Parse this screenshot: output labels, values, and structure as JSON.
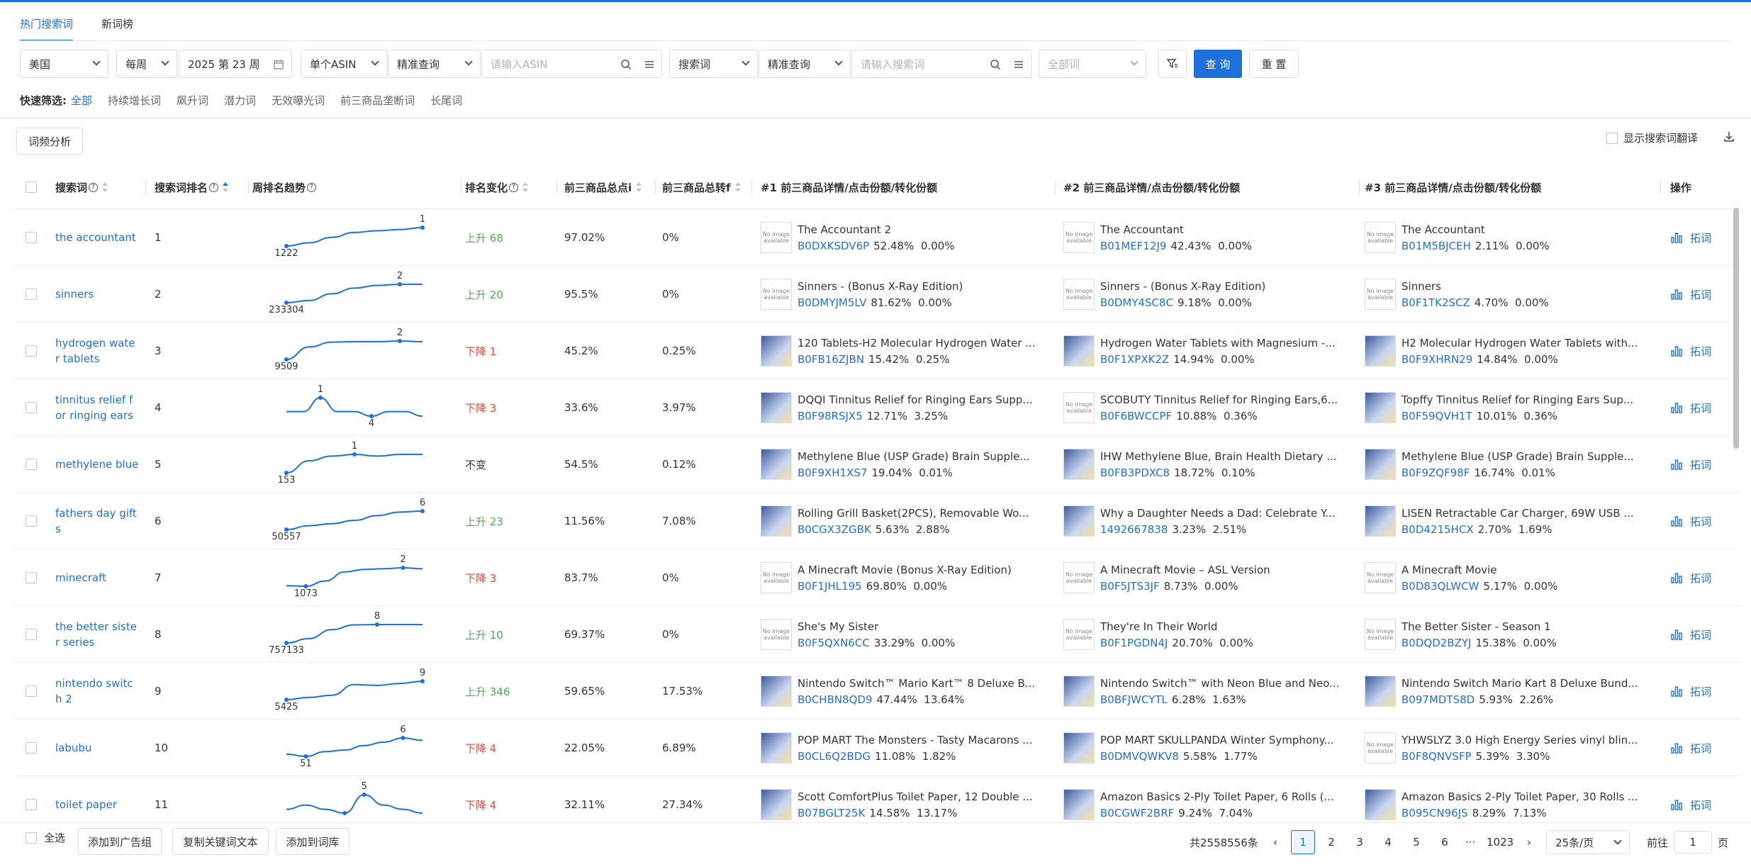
{
  "tabs": [
    "热门搜索词",
    "新词榜"
  ],
  "filters": {
    "country": "美国",
    "period": "每周",
    "week": "2025 第 23 周",
    "asin_mode": "单个ASIN",
    "asin_match": "精准查询",
    "asin_placeholder": "请输入ASIN",
    "kw_mode": "搜索词",
    "kw_match": "精准查询",
    "kw_placeholder": "请输入搜索词",
    "all_words": "全部词",
    "query_label": "查 询",
    "reset_label": "重 置"
  },
  "quick": {
    "label": "快速筛选:",
    "items": [
      "全部",
      "持续增长词",
      "飙升词",
      "潜力词",
      "无效曝光词",
      "前三商品垄断词",
      "长尾词"
    ]
  },
  "toolbar": {
    "freq_analysis": "词频分析",
    "show_translation": "显示搜索词翻译"
  },
  "columns": [
    "搜索词",
    "搜索词排名",
    "周排名趋势",
    "排名变化",
    "前三商品总点i",
    "前三商品总转f",
    "#1 前三商品详情/点击份额/转化份额",
    "#2 前三商品详情/点击份额/转化份额",
    "#3 前三商品详情/点击份额/转化份额",
    "操作"
  ],
  "colors": {
    "accent": "#1e6fd9",
    "up": "#4caf50",
    "down": "#f44336"
  },
  "rows": [
    {
      "kw": "the accountant",
      "rank": "1",
      "trend_min": "1222",
      "trend_max": "1",
      "trend": [
        1222,
        400,
        60,
        10,
        5,
        3,
        1
      ],
      "change": "上升 68",
      "dir": "up",
      "click": "97.02%",
      "conv": "0%",
      "p": [
        {
          "t": "The Accountant 2",
          "a": "B0DXKSDV6P",
          "c": "52.48%",
          "v": "0.00%",
          "img": false
        },
        {
          "t": "The Accountant",
          "a": "B01MEF12J9",
          "c": "42.43%",
          "v": "0.00%",
          "img": false
        },
        {
          "t": "The Accountant",
          "a": "B01M5BJCEH",
          "c": "2.11%",
          "v": "0.00%",
          "img": false
        }
      ]
    },
    {
      "kw": "sinners",
      "rank": "2",
      "trend_min": "233304",
      "trend_max": "2",
      "trend": [
        233304,
        60000,
        1000,
        30,
        5,
        2,
        2
      ],
      "change": "上升 20",
      "dir": "up",
      "click": "95.5%",
      "conv": "0%",
      "p": [
        {
          "t": "Sinners - (Bonus X-Ray Edition)",
          "a": "B0DMYJM5LV",
          "c": "81.62%",
          "v": "0.00%",
          "img": false
        },
        {
          "t": "Sinners - (Bonus X-Ray Edition)",
          "a": "B0DMY4SC8C",
          "c": "9.18%",
          "v": "0.00%",
          "img": false
        },
        {
          "t": "Sinners",
          "a": "B0F1TK2SCZ",
          "c": "4.70%",
          "v": "0.00%",
          "img": false
        }
      ]
    },
    {
      "kw": "hydrogen water tablets",
      "rank": "3",
      "trend_min": "9509",
      "trend_max": "2",
      "trend": [
        9509,
        40,
        4,
        3,
        3,
        2,
        3
      ],
      "change": "下降 1",
      "dir": "down",
      "click": "45.2%",
      "conv": "0.25%",
      "p": [
        {
          "t": "120 Tablets-H2 Molecular Hydrogen Water ...",
          "a": "B0FB16ZJBN",
          "c": "15.42%",
          "v": "0.25%",
          "img": true
        },
        {
          "t": "Hydrogen Water Tablets with Magnesium -...",
          "a": "B0F1XPXK2Z",
          "c": "14.94%",
          "v": "0.00%",
          "img": true
        },
        {
          "t": "H2 Molecular Hydrogen Water Tablets with...",
          "a": "B0F9XHRN29",
          "c": "14.84%",
          "v": "0.00%",
          "img": true
        }
      ]
    },
    {
      "kw": "tinnitus relief for ringing ears",
      "rank": "4",
      "trend_min": "4",
      "trend_max": "1",
      "trend": [
        3,
        3,
        1,
        3,
        3,
        4,
        3,
        3,
        4
      ],
      "change": "下降 3",
      "dir": "down",
      "click": "33.6%",
      "conv": "3.97%",
      "p": [
        {
          "t": "DQQI Tinnitus Relief for Ringing Ears Supp...",
          "a": "B0F98RSJX5",
          "c": "12.71%",
          "v": "3.25%",
          "img": true
        },
        {
          "t": "SCOBUTY Tinnitus Relief for Ringing Ears,6...",
          "a": "B0F6BWCCPF",
          "c": "10.88%",
          "v": "0.36%",
          "img": false
        },
        {
          "t": "Topffy Tinnitus Relief for Ringing Ears Sup...",
          "a": "B0F59QVH1T",
          "c": "10.01%",
          "v": "0.36%",
          "img": true
        }
      ]
    },
    {
      "kw": "methylene blue",
      "rank": "5",
      "trend_min": "153",
      "trend_max": "1",
      "trend": [
        153,
        8,
        2,
        1,
        2,
        1,
        1
      ],
      "change": "不变",
      "dir": "same",
      "click": "54.5%",
      "conv": "0.12%",
      "p": [
        {
          "t": "Methylene Blue (USP Grade) Brain Supple...",
          "a": "B0F9XH1XS7",
          "c": "19.04%",
          "v": "0.01%",
          "img": true
        },
        {
          "t": "IHW Methylene Blue, Brain Health Dietary ...",
          "a": "B0FB3PDXC8",
          "c": "18.72%",
          "v": "0.10%",
          "img": true
        },
        {
          "t": "Methylene Blue (USP Grade) Brain Supple...",
          "a": "B0F9ZQF98F",
          "c": "16.74%",
          "v": "0.01%",
          "img": true
        }
      ]
    },
    {
      "kw": "fathers day gifts",
      "rank": "6",
      "trend_min": "50557",
      "trend_max": "6",
      "trend": [
        50557,
        8000,
        3000,
        600,
        60,
        10,
        6
      ],
      "change": "上升 23",
      "dir": "up",
      "click": "11.56%",
      "conv": "7.08%",
      "p": [
        {
          "t": "Rolling Grill Basket(2PCS), Removable Wo...",
          "a": "B0CGX3ZGBK",
          "c": "5.63%",
          "v": "2.88%",
          "img": true
        },
        {
          "t": "Why a Daughter Needs a Dad: Celebrate Y...",
          "a": "1492667838",
          "c": "3.23%",
          "v": "2.51%",
          "img": true
        },
        {
          "t": "LISEN Retractable Car Charger, 69W USB ...",
          "a": "B0D4215HCX",
          "c": "2.70%",
          "v": "1.69%",
          "img": true
        }
      ]
    },
    {
      "kw": "minecraft",
      "rank": "7",
      "trend_min": "1073",
      "trend_max": "2",
      "trend": [
        900,
        1073,
        200,
        10,
        4,
        3,
        2,
        3
      ],
      "change": "下降 3",
      "dir": "down",
      "click": "83.7%",
      "conv": "0%",
      "p": [
        {
          "t": "A Minecraft Movie (Bonus X-Ray Edition)",
          "a": "B0F1JHL195",
          "c": "69.80%",
          "v": "0.00%",
          "img": false
        },
        {
          "t": "A Minecraft Movie – ASL Version",
          "a": "B0F5JTS3JF",
          "c": "8.73%",
          "v": "0.00%",
          "img": false
        },
        {
          "t": "A Minecraft Movie",
          "a": "B0D83QLWCW",
          "c": "5.17%",
          "v": "0.00%",
          "img": false
        }
      ]
    },
    {
      "kw": "the better sister series",
      "rank": "8",
      "trend_min": "757133",
      "trend_max": "8",
      "trend": [
        757133,
        50000,
        200,
        10,
        8,
        8,
        8
      ],
      "change": "上升 10",
      "dir": "up",
      "click": "69.37%",
      "conv": "0%",
      "p": [
        {
          "t": "She's My Sister",
          "a": "B0F5QXN6CC",
          "c": "33.29%",
          "v": "0.00%",
          "img": false
        },
        {
          "t": "They're In Their World",
          "a": "B0F1PGDN4J",
          "c": "20.70%",
          "v": "0.00%",
          "img": false
        },
        {
          "t": "The Better Sister - Season 1",
          "a": "B0DQD2BZYJ",
          "c": "15.38%",
          "v": "0.00%",
          "img": false
        }
      ]
    },
    {
      "kw": "nintendo switch 2",
      "rank": "9",
      "trend_min": "5425",
      "trend_max": "9",
      "trend": [
        5425,
        2500,
        1200,
        30,
        40,
        20,
        9
      ],
      "change": "上升 346",
      "dir": "up",
      "click": "59.65%",
      "conv": "17.53%",
      "p": [
        {
          "t": "Nintendo Switch™ Mario Kart™ 8 Deluxe B...",
          "a": "B0CHBN8QD9",
          "c": "47.44%",
          "v": "13.64%",
          "img": true
        },
        {
          "t": "Nintendo Switch™ with Neon Blue and Neo...",
          "a": "B0BFJWCYTL",
          "c": "6.28%",
          "v": "1.63%",
          "img": true
        },
        {
          "t": "Nintendo Switch Mario Kart 8 Deluxe Bund...",
          "a": "B097MDTS8D",
          "c": "5.93%",
          "v": "2.26%",
          "img": true
        }
      ]
    },
    {
      "kw": "labubu",
      "rank": "10",
      "trend_min": "51",
      "trend_max": "6",
      "trend": [
        40,
        51,
        30,
        25,
        15,
        10,
        6,
        8
      ],
      "change": "下降 4",
      "dir": "down",
      "click": "22.05%",
      "conv": "6.89%",
      "p": [
        {
          "t": "POP MART The Monsters - Tasty Macarons ...",
          "a": "B0CL6Q2BDG",
          "c": "11.08%",
          "v": "1.82%",
          "img": true
        },
        {
          "t": "POP MART SKULLPANDA Winter Symphony...",
          "a": "B0DMVQWKV8",
          "c": "5.58%",
          "v": "1.77%",
          "img": true
        },
        {
          "t": "YHWSLYZ 3.0 High Energy Series vinyl blin...",
          "a": "B0F8QNVSFP",
          "c": "5.39%",
          "v": "3.30%",
          "img": false
        }
      ]
    },
    {
      "kw": "toilet paper",
      "rank": "11",
      "trend_min": "",
      "trend_max": "5",
      "trend": [
        8,
        7,
        8,
        9,
        5,
        7,
        8,
        9
      ],
      "change": "下降 4",
      "dir": "down",
      "click": "32.11%",
      "conv": "27.34%",
      "p": [
        {
          "t": "Scott ComfortPlus Toilet Paper, 12 Double ...",
          "a": "B07BGLT25K",
          "c": "14.58%",
          "v": "13.17%",
          "img": true
        },
        {
          "t": "Amazon Basics 2-Ply Toilet Paper, 6 Rolls (...",
          "a": "B0CGWF2BRF",
          "c": "9.24%",
          "v": "7.04%",
          "img": true
        },
        {
          "t": "Amazon Basics 2-Ply Toilet Paper, 30 Rolls ...",
          "a": "B095CN96JS",
          "c": "8.29%",
          "v": "7.13%",
          "img": true
        }
      ]
    }
  ],
  "row_ops": {
    "rewords": "拓词"
  },
  "no_image": "No image available",
  "footer": {
    "select_all": "全选",
    "add_to_adgroup": "添加到广告组",
    "copy_keywords": "复制关键词文本",
    "add_to_lib": "添加到词库",
    "total": "共2558556条",
    "pages": [
      "1",
      "2",
      "3",
      "4",
      "5",
      "6"
    ],
    "ellipsis": "···",
    "last_page": "1023",
    "page_size": "25条/页",
    "goto_label": "前往",
    "goto_value": "1",
    "page_suffix": "页"
  }
}
